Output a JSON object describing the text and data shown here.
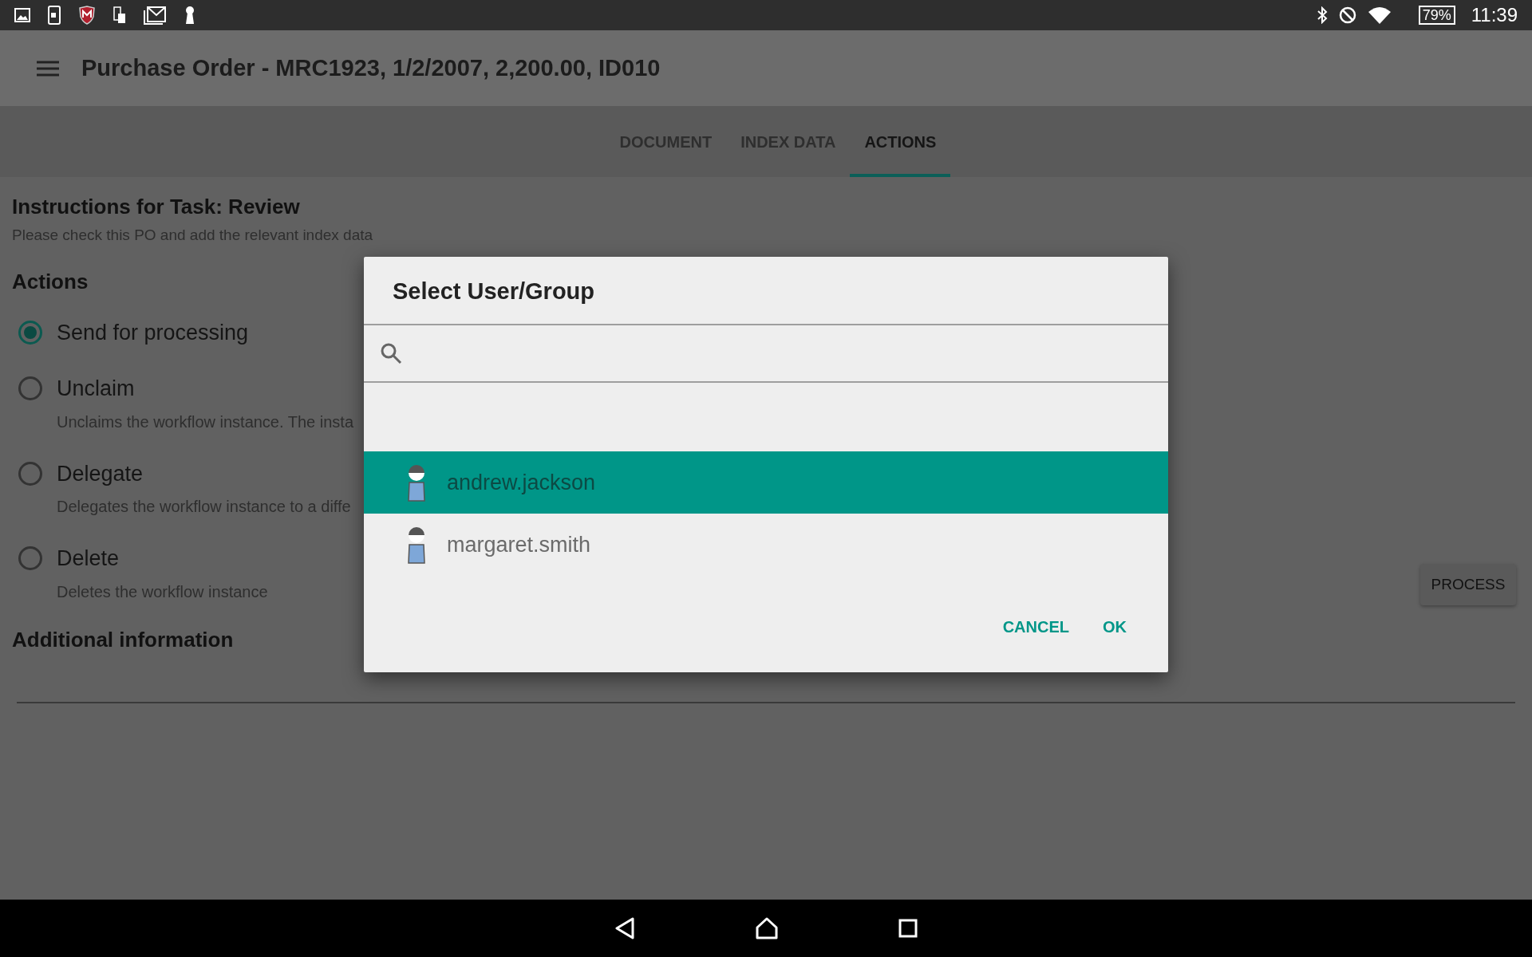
{
  "status_bar": {
    "battery": "79%",
    "time": "11:39"
  },
  "app_bar": {
    "title": "Purchase Order - MRC1923, 1/2/2007, 2,200.00, ID010"
  },
  "tabs": [
    {
      "label": "DOCUMENT",
      "selected": false
    },
    {
      "label": "INDEX DATA",
      "selected": false
    },
    {
      "label": "ACTIONS",
      "selected": true
    }
  ],
  "instructions": {
    "title": "Instructions for Task: Review",
    "text": "Please check this PO and add the relevant index data"
  },
  "actions": {
    "heading": "Actions",
    "options": [
      {
        "label": "Send for processing",
        "selected": true
      },
      {
        "label": "Unclaim",
        "description": "Unclaims the workflow instance. The insta",
        "selected": false
      },
      {
        "label": "Delegate",
        "description": "Delegates the workflow instance to a diffe",
        "selected": false
      },
      {
        "label": "Delete",
        "description": "Deletes the workflow instance",
        "selected": false
      }
    ]
  },
  "process_button": "PROCESS",
  "additional_information": {
    "heading": "Additional information"
  },
  "dialog": {
    "title": "Select User/Group",
    "users": [
      {
        "name": "andrew.jackson",
        "selected": true
      },
      {
        "name": "margaret.smith",
        "selected": false
      }
    ],
    "buttons": [
      "CANCEL",
      "OK"
    ]
  }
}
